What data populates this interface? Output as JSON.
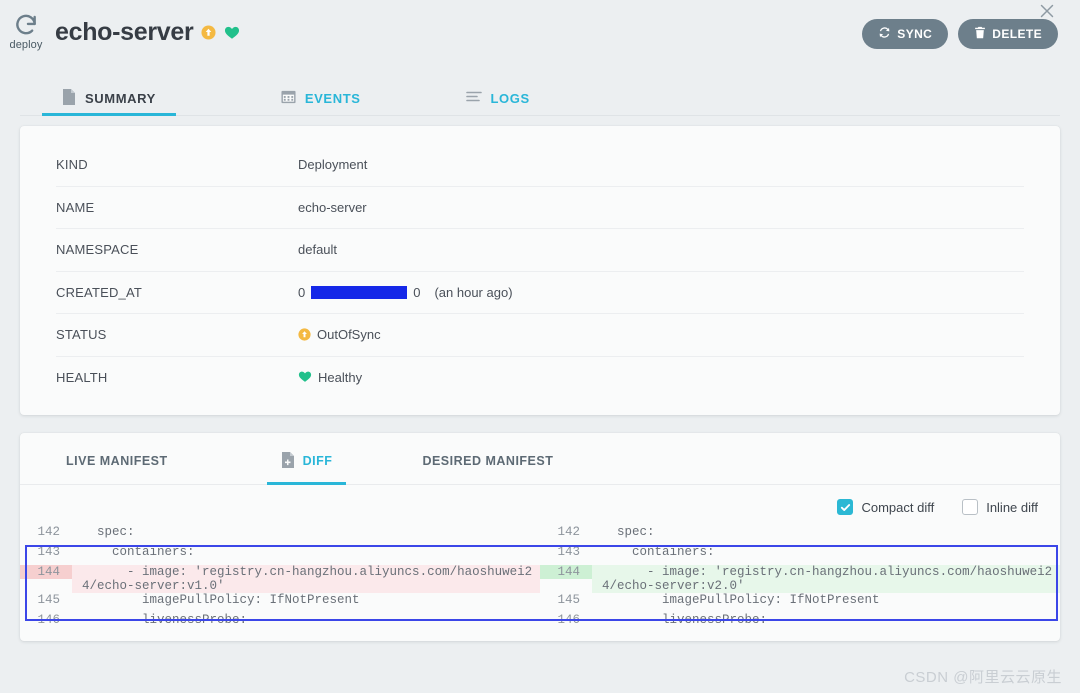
{
  "header": {
    "kind_icon": "deploy-rotate-icon",
    "kind_label": "deploy",
    "title": "echo-server",
    "sync_badge_icon": "out-of-sync-arrow-icon",
    "health_badge_icon": "heart-icon",
    "sync_button": "SYNC",
    "sync_button_icon": "refresh-icon",
    "delete_button": "DELETE",
    "delete_button_icon": "trash-icon",
    "close_icon": "close-icon"
  },
  "tabs": [
    {
      "label": "SUMMARY",
      "icon": "document-icon",
      "active": true
    },
    {
      "label": "EVENTS",
      "icon": "calendar-icon",
      "active": false
    },
    {
      "label": "LOGS",
      "icon": "lines-icon",
      "active": false
    }
  ],
  "summary": {
    "rows": [
      {
        "label": "KIND",
        "value": "Deployment"
      },
      {
        "label": "NAME",
        "value": "echo-server"
      },
      {
        "label": "NAMESPACE",
        "value": "default"
      },
      {
        "label": "CREATED_AT",
        "prefix": "0",
        "suffix": "0",
        "ago": "(an hour ago)",
        "redacted": true
      },
      {
        "label": "STATUS",
        "value": "OutOfSync",
        "icon": "out-of-sync-arrow-icon"
      },
      {
        "label": "HEALTH",
        "value": "Healthy",
        "icon": "heart-icon"
      }
    ]
  },
  "diff_panel": {
    "tabs": [
      {
        "label": "LIVE MANIFEST",
        "active": false
      },
      {
        "label": "DIFF",
        "icon": "document-diff-icon",
        "active": true
      },
      {
        "label": "DESIRED MANIFEST",
        "active": false
      }
    ],
    "options": [
      {
        "label": "Compact diff",
        "checked": true
      },
      {
        "label": "Inline diff",
        "checked": false
      }
    ],
    "left_lines": [
      {
        "num": "142",
        "text": "  spec:",
        "type": "context"
      },
      {
        "num": "143",
        "text": "    containers:",
        "type": "context"
      },
      {
        "num": "144",
        "text": "      - image: 'registry.cn-hangzhou.aliyuncs.com/haoshuwei24/echo-server:v1.0'",
        "type": "del"
      },
      {
        "num": "145",
        "text": "        imagePullPolicy: IfNotPresent",
        "type": "context"
      },
      {
        "num": "146",
        "text": "        livenessProbe:",
        "type": "context"
      }
    ],
    "right_lines": [
      {
        "num": "142",
        "text": "  spec:",
        "type": "context"
      },
      {
        "num": "143",
        "text": "    containers:",
        "type": "context"
      },
      {
        "num": "144",
        "text": "      - image: 'registry.cn-hangzhou.aliyuncs.com/haoshuwei24/echo-server:v2.0'",
        "type": "add"
      },
      {
        "num": "145",
        "text": "        imagePullPolicy: IfNotPresent",
        "type": "context"
      },
      {
        "num": "146",
        "text": "        livenessProbe:",
        "type": "context"
      }
    ]
  },
  "watermark": "CSDN @阿里云云原生",
  "colors": {
    "accent": "#29b6d8",
    "button": "#6d7f8b",
    "out_of_sync": "#f4b942",
    "healthy": "#21c08b",
    "diff_add": "#e7f7ea",
    "diff_del": "#fbe9eb",
    "highlight_border": "#3b46e8",
    "redaction": "#1528e8"
  }
}
